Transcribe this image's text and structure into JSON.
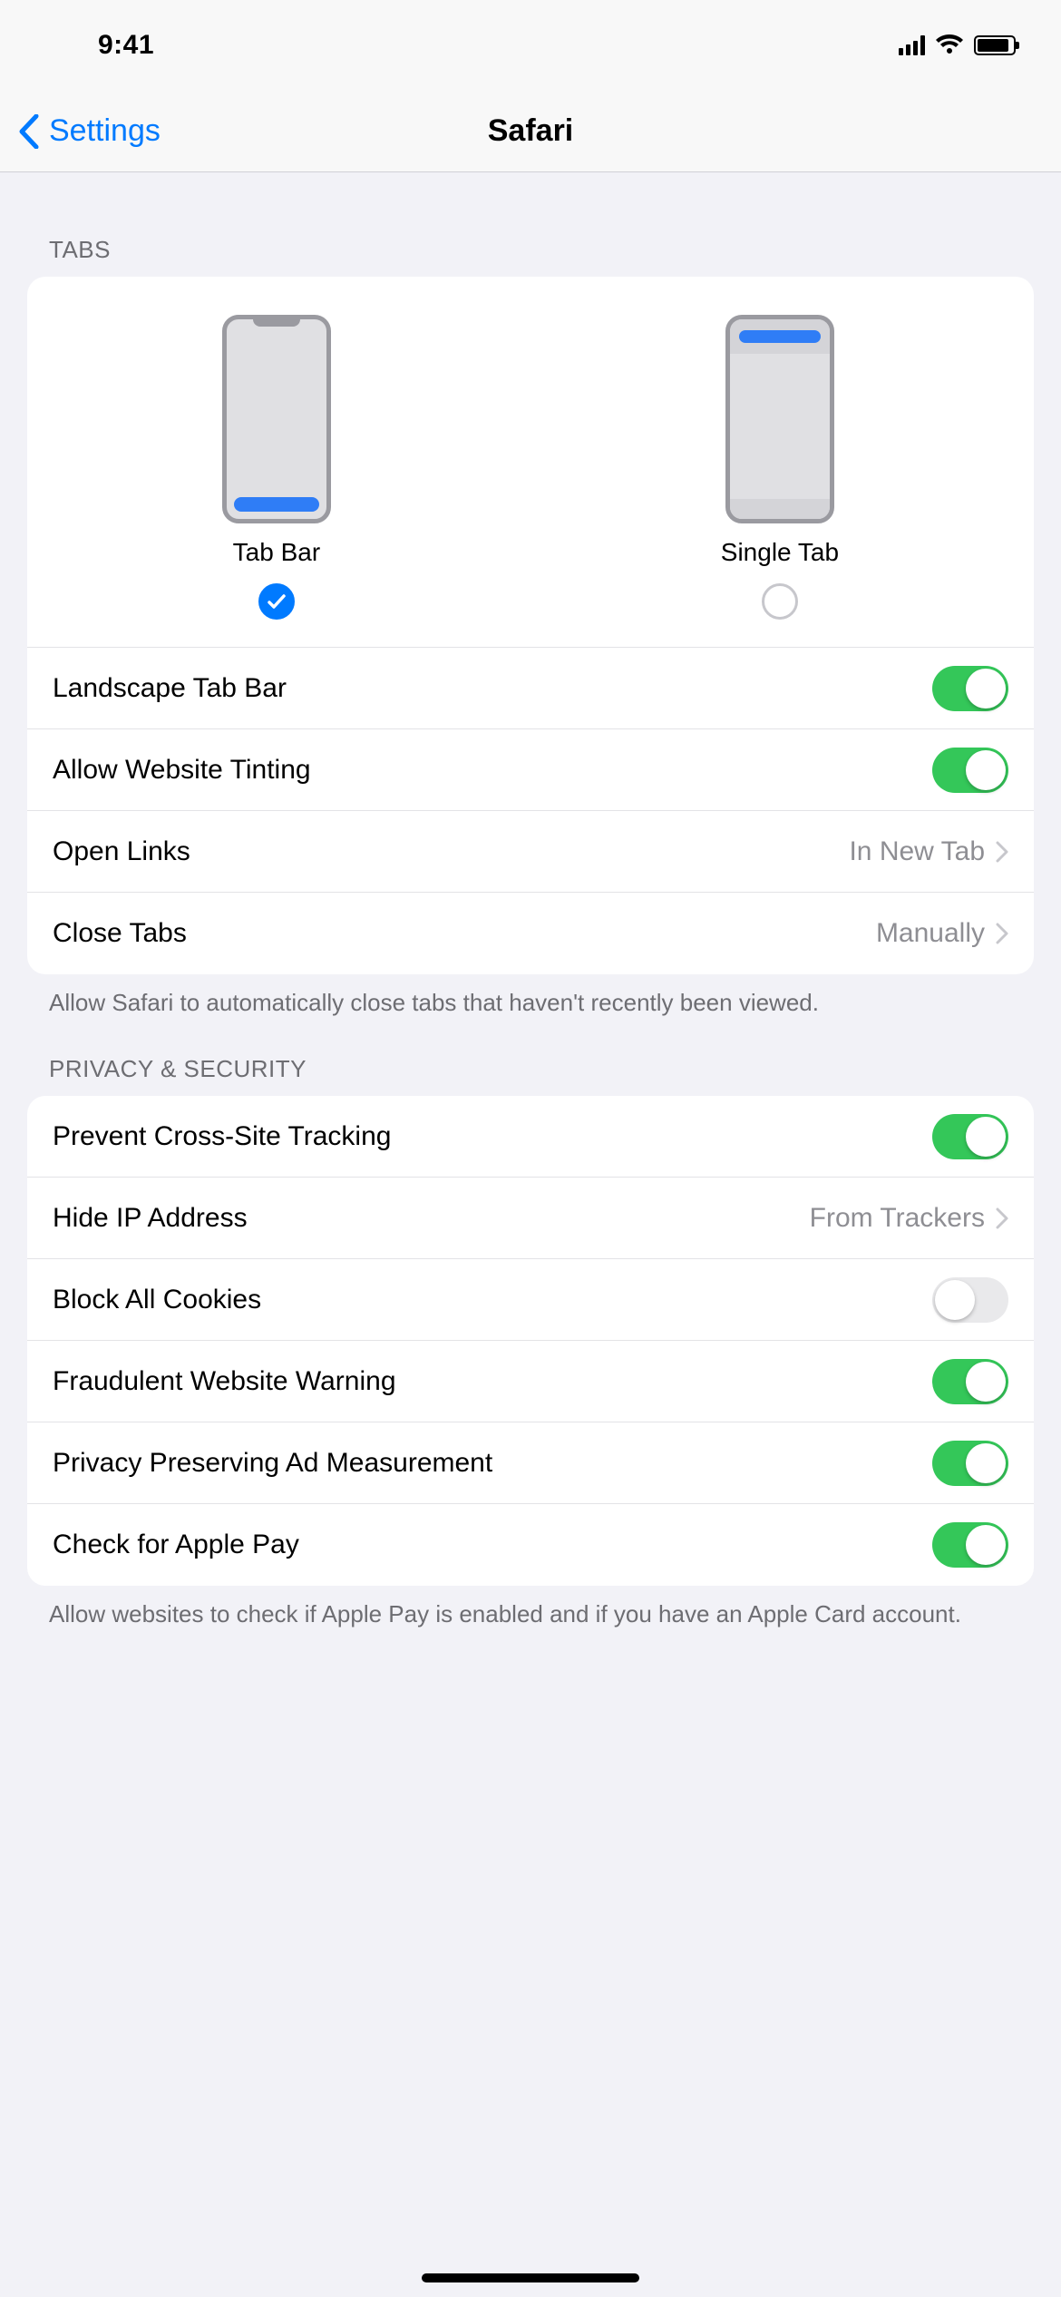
{
  "status": {
    "time": "9:41"
  },
  "nav": {
    "back_label": "Settings",
    "title": "Safari"
  },
  "tabs_section": {
    "header": "TABS",
    "options": [
      {
        "label": "Tab Bar",
        "selected": true
      },
      {
        "label": "Single Tab",
        "selected": false
      }
    ],
    "rows": {
      "landscape_tab_bar": {
        "label": "Landscape Tab Bar",
        "on": true
      },
      "allow_website_tinting": {
        "label": "Allow Website Tinting",
        "on": true
      },
      "open_links": {
        "label": "Open Links",
        "value": "In New Tab"
      },
      "close_tabs": {
        "label": "Close Tabs",
        "value": "Manually"
      }
    },
    "footer": "Allow Safari to automatically close tabs that haven't recently been viewed."
  },
  "privacy_section": {
    "header": "PRIVACY & SECURITY",
    "rows": {
      "prevent_tracking": {
        "label": "Prevent Cross-Site Tracking",
        "on": true
      },
      "hide_ip": {
        "label": "Hide IP Address",
        "value": "From Trackers"
      },
      "block_cookies": {
        "label": "Block All Cookies",
        "on": false
      },
      "fraud_warning": {
        "label": "Fraudulent Website Warning",
        "on": true
      },
      "ad_measurement": {
        "label": "Privacy Preserving Ad Measurement",
        "on": true
      },
      "apple_pay": {
        "label": "Check for Apple Pay",
        "on": true
      }
    },
    "footer": "Allow websites to check if Apple Pay is enabled and if you have an Apple Card account."
  }
}
